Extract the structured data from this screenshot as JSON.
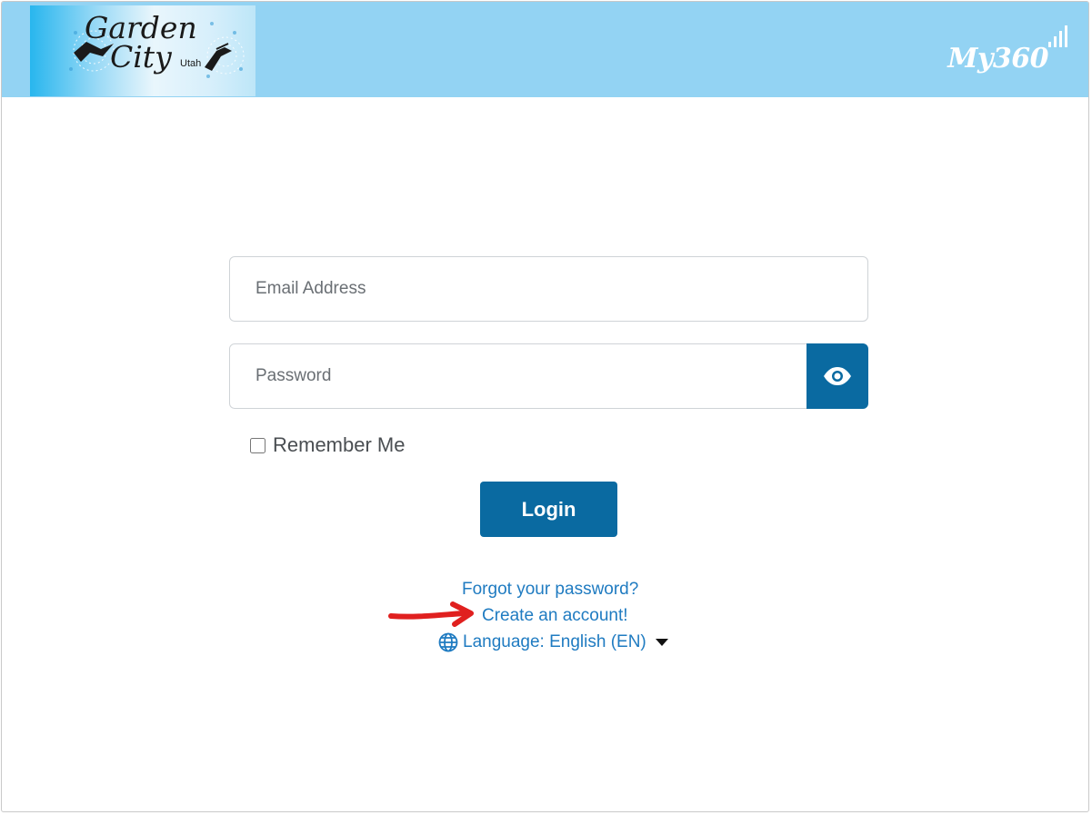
{
  "header": {
    "logo": {
      "line1": "Garden",
      "line2": "City",
      "sub": "Utah"
    },
    "brand": "My360"
  },
  "form": {
    "email_placeholder": "Email Address",
    "password_placeholder": "Password",
    "remember_label": "Remember Me",
    "login_label": "Login"
  },
  "links": {
    "forgot": "Forgot your password?",
    "create": "Create an account!",
    "language": "Language: English (EN)"
  },
  "colors": {
    "header_bg": "#93d3f3",
    "primary": "#0a6aa1",
    "link": "#1f7bc1",
    "annotation_arrow": "#e0201f"
  }
}
